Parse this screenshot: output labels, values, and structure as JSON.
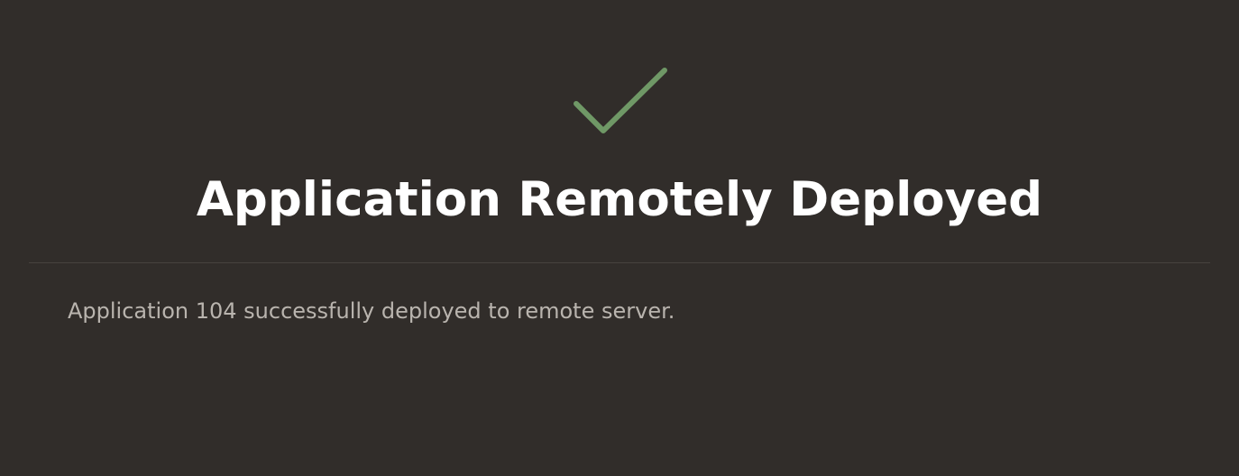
{
  "dialog": {
    "icon": "checkmark-icon",
    "title": "Application Remotely Deployed",
    "message": "Application 104 successfully deployed to remote server."
  },
  "colors": {
    "background": "#312d2a",
    "success": "#6f9866",
    "title": "#ffffff",
    "message": "#b9b4ae",
    "divider": "#47423e"
  }
}
